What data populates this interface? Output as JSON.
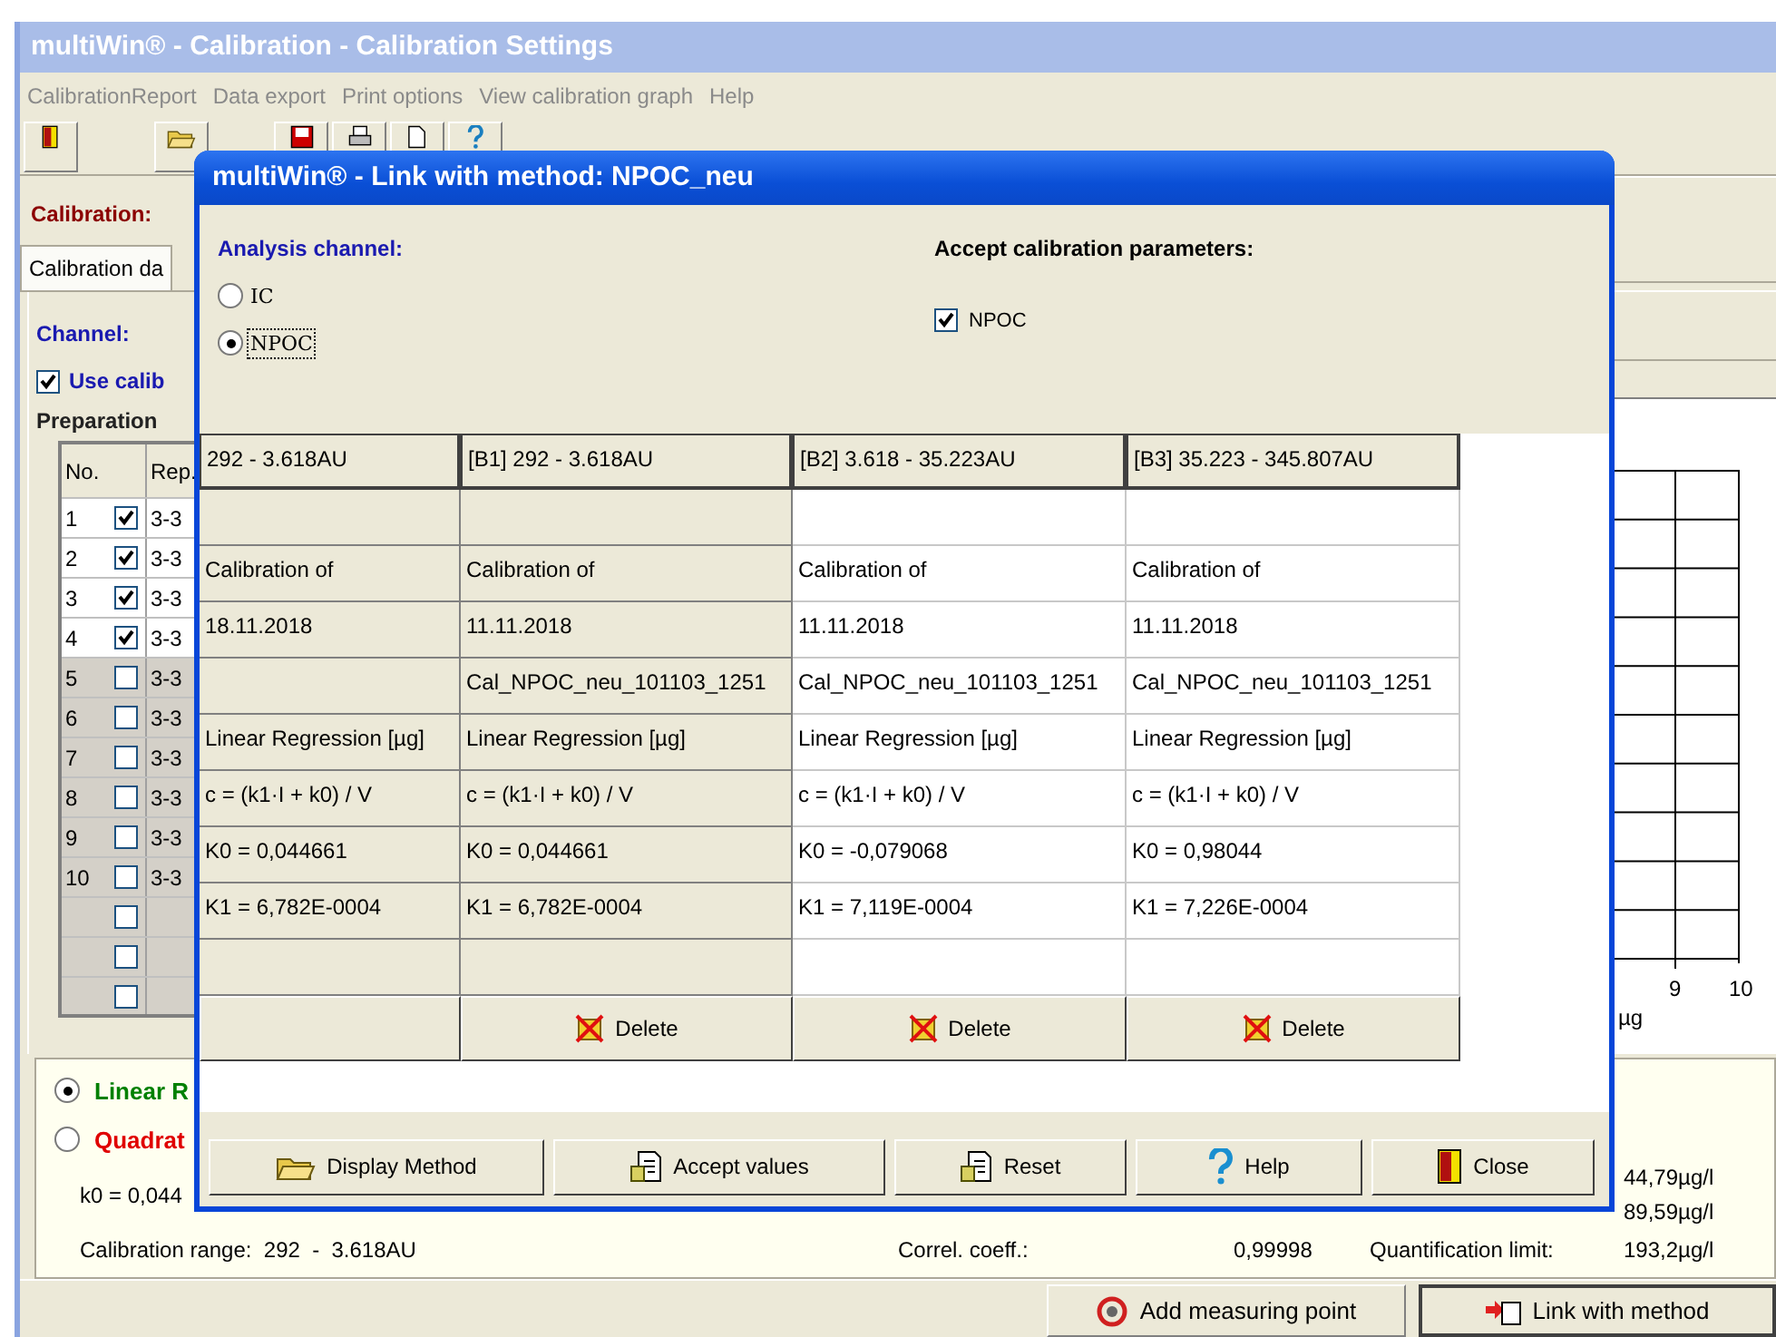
{
  "window": {
    "title": "multiWin® - Calibration - Calibration Settings"
  },
  "menu": [
    "CalibrationReport",
    "Data export",
    "Print options",
    "View calibration graph",
    "Help"
  ],
  "calibration_label": "Calibration:",
  "tab": "Calibration da",
  "channel_label": "Channel:",
  "use_calibration": {
    "label": "Use calib",
    "checked": true
  },
  "preparation_label": "Preparation",
  "prep_table": {
    "columns": [
      "No.",
      "Rep."
    ],
    "rows": [
      {
        "no": "1",
        "checked": true,
        "rep": "3-3"
      },
      {
        "no": "2",
        "checked": true,
        "rep": "3-3"
      },
      {
        "no": "3",
        "checked": true,
        "rep": "3-3"
      },
      {
        "no": "4",
        "checked": true,
        "rep": "3-3"
      },
      {
        "no": "5",
        "checked": false,
        "rep": "3-3"
      },
      {
        "no": "6",
        "checked": false,
        "rep": "3-3"
      },
      {
        "no": "7",
        "checked": false,
        "rep": "3-3"
      },
      {
        "no": "8",
        "checked": false,
        "rep": "3-3"
      },
      {
        "no": "9",
        "checked": false,
        "rep": "3-3"
      },
      {
        "no": "10",
        "checked": false,
        "rep": "3-3"
      },
      {
        "checked": false
      },
      {
        "checked": false
      },
      {
        "checked": false
      }
    ]
  },
  "graph": {
    "xticks": [
      "9",
      "10"
    ],
    "unit": "µg"
  },
  "fit": {
    "options": [
      {
        "kind": "linear",
        "label": "Linear R",
        "selected": true
      },
      {
        "kind": "quadratic",
        "label": "Quadrat",
        "selected": false
      }
    ],
    "k0": "k0 = 0,044",
    "range": "Calibration range:  292  -  3.618AU",
    "values": [
      "44,79µg/l",
      "89,59µg/l"
    ],
    "correl_label": "Correl. coeff.:",
    "correl": "0,99998",
    "quant_label": "Quantification limit:",
    "quant": "193,2µg/l"
  },
  "status_buttons": [
    {
      "kind": "add",
      "label": "Add measuring point"
    },
    {
      "kind": "link",
      "label": "Link with method"
    }
  ],
  "dialog": {
    "title": "multiWin® - Link with method: NPOC_neu",
    "channel_label": "Analysis channel:",
    "channels": [
      {
        "label": "IC",
        "selected": false
      },
      {
        "label": "NPOC",
        "selected": true
      }
    ],
    "accept_label": "Accept calibration parameters:",
    "accept": [
      {
        "label": "NPOC",
        "checked": true
      }
    ],
    "columns": [
      {
        "kind": "current",
        "selected": true,
        "header": "292  -  3.618AU",
        "cells": [
          null,
          "Calibration of",
          "18.11.2018",
          null,
          "Linear Regression [µg]",
          "c = (k1·I + k0) / V",
          "K0 = 0,044661",
          "K1 = 6,782E-0004",
          null
        ]
      },
      {
        "kind": "stored",
        "selected": true,
        "header": "[B1] 292  -  3.618AU",
        "cells": [
          null,
          "Calibration of",
          "11.11.2018",
          "Cal_NPOC_neu_101103_1251",
          "Linear Regression [µg]",
          "c = (k1·I + k0) / V",
          "K0 = 0,044661",
          "K1 = 6,782E-0004",
          null
        ],
        "delete": "Delete"
      },
      {
        "kind": "stored",
        "selected": false,
        "header": "[B2] 3.618  -  35.223AU",
        "cells": [
          null,
          "Calibration of",
          "11.11.2018",
          "Cal_NPOC_neu_101103_1251",
          "Linear Regression [µg]",
          "c = (k1·I + k0) / V",
          "K0 = -0,079068",
          "K1 = 7,119E-0004",
          null
        ],
        "delete": "Delete"
      },
      {
        "kind": "stored",
        "selected": false,
        "header": "[B3] 35.223  -  345.807AU",
        "cells": [
          null,
          "Calibration of",
          "11.11.2018",
          "Cal_NPOC_neu_101103_1251",
          "Linear Regression [µg]",
          "c = (k1·I + k0) / V",
          "K0 = 0,98044",
          "K1 = 7,226E-0004",
          null
        ],
        "delete": "Delete"
      }
    ],
    "buttons": [
      {
        "kind": "display",
        "label": "Display Method"
      },
      {
        "kind": "accept",
        "label": "Accept values"
      },
      {
        "kind": "reset",
        "label": "Reset"
      },
      {
        "kind": "help",
        "label": "Help"
      },
      {
        "kind": "close",
        "label": "Close"
      }
    ]
  }
}
